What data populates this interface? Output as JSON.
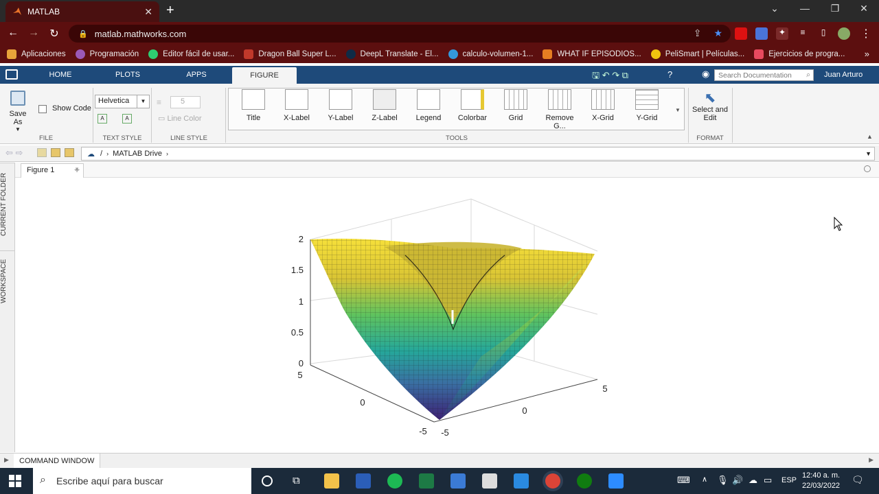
{
  "browser": {
    "tab_title": "MATLAB",
    "url": "matlab.mathworks.com",
    "bookmarks": [
      {
        "label": "Aplicaciones",
        "color": "#e8a33a"
      },
      {
        "label": "Programación",
        "color": "#9b59b6"
      },
      {
        "label": "Editor fácil de usar...",
        "color": "#2ecc71"
      },
      {
        "label": "Dragon Ball Super L...",
        "color": "#c0392b"
      },
      {
        "label": "DeepL Translate - El...",
        "color": "#0f2b46"
      },
      {
        "label": "calculo-volumen-1...",
        "color": "#3498db"
      },
      {
        "label": "WHAT IF EPISODIOS...",
        "color": "#e67e22"
      },
      {
        "label": "PeliSmart | Películas...",
        "color": "#f1c40f"
      },
      {
        "label": "Ejercicios de progra...",
        "color": "#e84a5f"
      }
    ]
  },
  "matlab": {
    "tabs": [
      "HOME",
      "PLOTS",
      "APPS",
      "FIGURE"
    ],
    "search_placeholder": "Search Documentation",
    "user": "Juan Arturo",
    "file": {
      "save_as": "Save As",
      "show_code": "Show Code",
      "section": "FILE"
    },
    "text_style": {
      "font": "Helvetica",
      "section": "TEXT STYLE"
    },
    "line_style": {
      "width": "5",
      "line_color": "Line Color",
      "section": "LINE STYLE"
    },
    "tools": [
      "Title",
      "X-Label",
      "Y-Label",
      "Z-Label",
      "Legend",
      "Colorbar",
      "Grid",
      "Remove G...",
      "X-Grid",
      "Y-Grid"
    ],
    "tools_section": "TOOLS",
    "format": {
      "label1": "Select and",
      "label2": "Edit",
      "section": "FORMAT"
    },
    "path": {
      "sep": "/",
      "folder": "MATLAB Drive"
    },
    "sidebar": {
      "current_folder": "CURRENT FOLDER",
      "workspace": "WORKSPACE"
    },
    "figure_tab": "Figure 1",
    "command_window": "COMMAND WINDOW"
  },
  "plot": {
    "z_ticks": [
      "2",
      "1.5",
      "1",
      "0.5",
      "0"
    ],
    "x_ticks": [
      "5",
      "0",
      "-5"
    ],
    "y_ticks": [
      "-5",
      "0",
      "5"
    ]
  },
  "taskbar": {
    "search": "Escribe aquí para buscar",
    "lang": "ESP",
    "time": "12:40 a. m.",
    "date": "22/03/2022"
  }
}
